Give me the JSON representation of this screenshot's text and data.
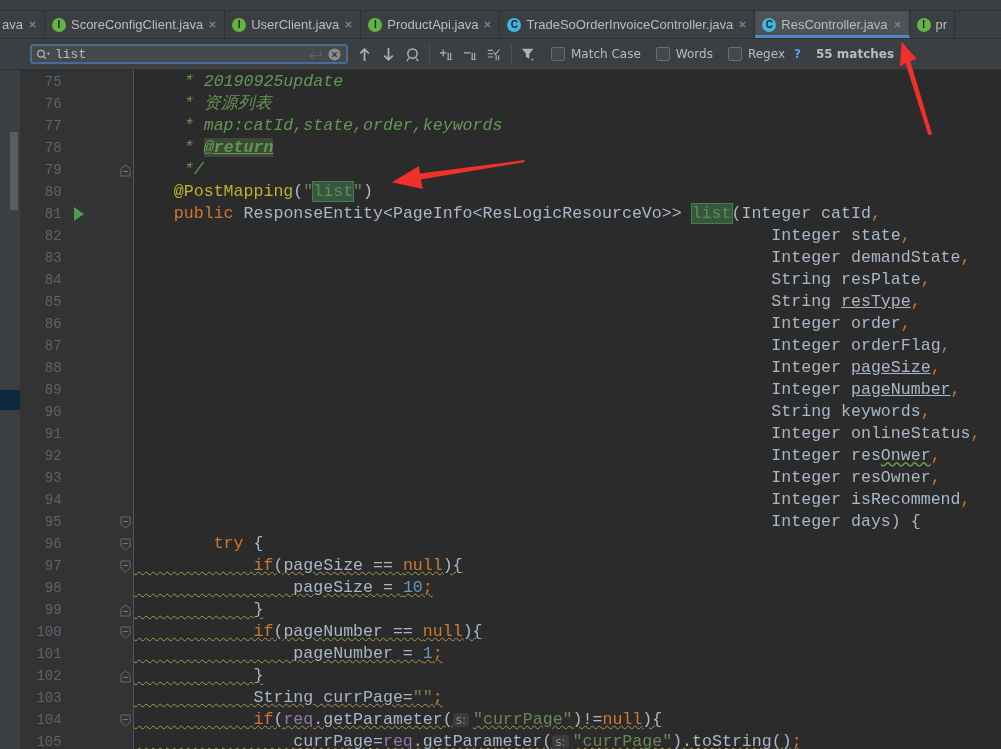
{
  "tabs": [
    {
      "label": "ava",
      "selected": false,
      "closable": true
    },
    {
      "label": "ScoreConfigClient.java",
      "kind": "interface",
      "badge": "I",
      "selected": false,
      "closable": true
    },
    {
      "label": "UserClient.java",
      "kind": "interface",
      "badge": "I",
      "selected": false,
      "closable": true
    },
    {
      "label": "ProductApi.java",
      "kind": "interface",
      "badge": "I",
      "selected": false,
      "closable": true
    },
    {
      "label": "TradeSoOrderInvoiceController.java",
      "kind": "class",
      "badge": "C",
      "selected": false,
      "closable": true
    },
    {
      "label": "ResController.java",
      "kind": "class",
      "badge": "C",
      "selected": true,
      "closable": true
    },
    {
      "label": "pr",
      "kind": "interface",
      "badge": "I",
      "selected": false,
      "closable": false
    }
  ],
  "search": {
    "value": "list",
    "options": [
      {
        "label": "Match Case",
        "checked": false
      },
      {
        "label": "Words",
        "checked": false
      },
      {
        "label": "Regex",
        "checked": false
      }
    ],
    "help": "?",
    "matches": "55 matches"
  },
  "lines": [
    {
      "number": "75",
      "tokens": [
        {
          "t": "     * 20190925update",
          "kind": "comment"
        }
      ]
    },
    {
      "number": "76",
      "tokens": [
        {
          "t": "     * 资源列表",
          "kind": "comment"
        }
      ]
    },
    {
      "number": "77",
      "tokens": [
        {
          "t": "     * map:catId,state,order,keywords",
          "kind": "comment"
        }
      ]
    },
    {
      "number": "78",
      "tokens": [
        {
          "t": "     * ",
          "kind": "comment"
        },
        {
          "t": "@return",
          "kind": "doctag"
        }
      ]
    },
    {
      "number": "79",
      "gutter": {
        "kind": "fold-end"
      },
      "tokens": [
        {
          "t": "     */",
          "kind": "comment"
        }
      ]
    },
    {
      "number": "80",
      "tokens": [
        {
          "t": "    @PostMapping",
          "kind": "annotation"
        },
        {
          "t": "(",
          "kind": "plain"
        },
        {
          "t": "\"",
          "kind": "string"
        },
        {
          "t": "list",
          "kind": "match"
        },
        {
          "t": "\"",
          "kind": "string"
        },
        {
          "t": ")",
          "kind": "plain"
        }
      ]
    },
    {
      "number": "81",
      "gutter": {
        "kind": "run"
      },
      "tokens": [
        {
          "t": "    public",
          "kind": "keyword"
        },
        {
          "t": " ResponseEntity<PageInfo<ResLogicResourceVo>> ",
          "kind": "plain"
        },
        {
          "t": "list",
          "kind": "match"
        },
        {
          "t": "(Integer catId",
          "kind": "plain"
        },
        {
          "t": ",",
          "kind": "punct"
        }
      ]
    },
    {
      "number": "82",
      "tokens": [
        {
          "t": "                                                                Integer state",
          "kind": "plain"
        },
        {
          "t": ",",
          "kind": "punct"
        }
      ]
    },
    {
      "number": "83",
      "tokens": [
        {
          "t": "                                                                Integer demandState",
          "kind": "plain"
        },
        {
          "t": ",",
          "kind": "punct"
        }
      ]
    },
    {
      "number": "84",
      "tokens": [
        {
          "t": "                                                                String resPlate",
          "kind": "plain"
        },
        {
          "t": ",",
          "kind": "punct"
        }
      ]
    },
    {
      "number": "85",
      "tokens": [
        {
          "t": "                                                                String ",
          "kind": "plain"
        },
        {
          "t": "resType",
          "kind": "underline"
        },
        {
          "t": ",",
          "kind": "punct"
        }
      ]
    },
    {
      "number": "86",
      "tokens": [
        {
          "t": "                                                                Integer order",
          "kind": "plain"
        },
        {
          "t": ",",
          "kind": "punct"
        }
      ]
    },
    {
      "number": "87",
      "tokens": [
        {
          "t": "                                                                Integer orderFlag",
          "kind": "plain"
        },
        {
          "t": ",",
          "kind": "punct"
        }
      ]
    },
    {
      "number": "88",
      "tokens": [
        {
          "t": "                                                                Integer ",
          "kind": "plain"
        },
        {
          "t": "pageSize",
          "kind": "underline"
        },
        {
          "t": ",",
          "kind": "punct"
        }
      ]
    },
    {
      "number": "89",
      "tokens": [
        {
          "t": "                                                                Integer ",
          "kind": "plain"
        },
        {
          "t": "pageNumber",
          "kind": "underline"
        },
        {
          "t": ",",
          "kind": "punct"
        }
      ]
    },
    {
      "number": "90",
      "tokens": [
        {
          "t": "                                                                String keywords",
          "kind": "plain"
        },
        {
          "t": ",",
          "kind": "punct"
        }
      ]
    },
    {
      "number": "91",
      "tokens": [
        {
          "t": "                                                                Integer onlineStatus",
          "kind": "plain"
        },
        {
          "t": ",",
          "kind": "punct"
        }
      ]
    },
    {
      "number": "92",
      "tokens": [
        {
          "t": "                                                                Integer res",
          "kind": "plain"
        },
        {
          "t": "Onwer",
          "kind": "typo"
        },
        {
          "t": ",",
          "kind": "punct"
        }
      ]
    },
    {
      "number": "93",
      "tokens": [
        {
          "t": "                                                                Integer resOwner",
          "kind": "plain"
        },
        {
          "t": ",",
          "kind": "punct"
        }
      ]
    },
    {
      "number": "94",
      "tokens": [
        {
          "t": "                                                                Integer isRecommend",
          "kind": "plain"
        },
        {
          "t": ",",
          "kind": "punct"
        }
      ]
    },
    {
      "number": "95",
      "gutter": {
        "kind": "fold"
      },
      "tokens": [
        {
          "t": "                                                                Integer days) {",
          "kind": "plain"
        }
      ]
    },
    {
      "number": "96",
      "gutter": {
        "kind": "fold"
      },
      "tokens": [
        {
          "t": "        try",
          "kind": "keyword"
        },
        {
          "t": " {",
          "kind": "plain"
        }
      ]
    },
    {
      "number": "97",
      "gutter": {
        "kind": "fold"
      },
      "tokens": [
        {
          "t": "            if",
          "kind": "keyword",
          "warn": true
        },
        {
          "t": "(pageSize == ",
          "kind": "plain",
          "warn": true
        },
        {
          "t": "null",
          "kind": "keyword",
          "warn": true
        },
        {
          "t": "){",
          "kind": "plain",
          "warn": true
        }
      ]
    },
    {
      "number": "98",
      "tokens": [
        {
          "t": "                pageSize = ",
          "kind": "plain",
          "warn": true
        },
        {
          "t": "10",
          "kind": "number",
          "warn": true
        },
        {
          "t": ";",
          "kind": "punct",
          "warn": true
        }
      ]
    },
    {
      "number": "99",
      "gutter": {
        "kind": "fold-end"
      },
      "tokens": [
        {
          "t": "            }",
          "kind": "plain",
          "warn": true
        }
      ]
    },
    {
      "number": "100",
      "gutter": {
        "kind": "fold"
      },
      "tokens": [
        {
          "t": "            if",
          "kind": "keyword",
          "warn": true
        },
        {
          "t": "(pageNumber == ",
          "kind": "plain",
          "warn": true
        },
        {
          "t": "null",
          "kind": "keyword",
          "warn": true
        },
        {
          "t": "){",
          "kind": "plain",
          "warn": true
        }
      ]
    },
    {
      "number": "101",
      "tokens": [
        {
          "t": "                pageNumber = ",
          "kind": "plain",
          "warn": true
        },
        {
          "t": "1",
          "kind": "number",
          "warn": true
        },
        {
          "t": ";",
          "kind": "punct",
          "warn": true
        }
      ]
    },
    {
      "number": "102",
      "gutter": {
        "kind": "fold-end"
      },
      "tokens": [
        {
          "t": "            }",
          "kind": "plain",
          "warn": true
        }
      ]
    },
    {
      "number": "103",
      "tokens": [
        {
          "t": "            String currPage=",
          "kind": "plain",
          "warn": true
        },
        {
          "t": "\"\"",
          "kind": "string",
          "warn": true
        },
        {
          "t": ";",
          "kind": "punct",
          "warn": true
        }
      ]
    },
    {
      "number": "104",
      "gutter": {
        "kind": "fold"
      },
      "tokens": [
        {
          "t": "            if",
          "kind": "keyword",
          "warn": true
        },
        {
          "t": "(",
          "kind": "plain",
          "warn": true
        },
        {
          "t": "req",
          "kind": "field",
          "warn": true
        },
        {
          "t": ".getParameter(",
          "kind": "plain",
          "warn": true
        },
        {
          "t": "s:",
          "kind": "hint"
        },
        {
          "t": "\"currPage\"",
          "kind": "string",
          "warn": true
        },
        {
          "t": ")!=",
          "kind": "plain",
          "warn": true
        },
        {
          "t": "null",
          "kind": "keyword",
          "warn": true
        },
        {
          "t": "){",
          "kind": "plain",
          "warn": true
        }
      ]
    },
    {
      "number": "105",
      "tokens": [
        {
          "t": "                currPage=",
          "kind": "plain",
          "warn": true
        },
        {
          "t": "req",
          "kind": "field",
          "warn": true
        },
        {
          "t": ".getParameter(",
          "kind": "plain",
          "warn": true
        },
        {
          "t": "s:",
          "kind": "hint"
        },
        {
          "t": "\"currPage\"",
          "kind": "string",
          "warn": true
        },
        {
          "t": ").toString()",
          "kind": "plain",
          "warn": true
        },
        {
          "t": ";",
          "kind": "punct",
          "warn": true
        }
      ]
    }
  ]
}
